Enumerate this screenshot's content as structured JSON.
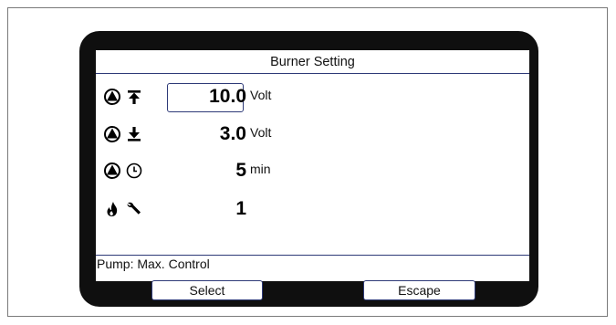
{
  "screen": {
    "title": "Burner Setting",
    "rows": [
      {
        "icons": [
          "pump-icon",
          "arrow-up-to-bar-icon"
        ],
        "value": "10.0",
        "unit": "Volt",
        "selected": true
      },
      {
        "icons": [
          "pump-icon",
          "arrow-down-to-bar-icon"
        ],
        "value": "3.0",
        "unit": "Volt",
        "selected": false
      },
      {
        "icons": [
          "pump-icon",
          "clock-icon"
        ],
        "value": "5",
        "unit": "min",
        "selected": false
      },
      {
        "icons": [
          "flame-icon",
          "wrench-icon"
        ],
        "value": "1",
        "unit": "",
        "selected": false
      }
    ],
    "status": "Pump: Max. Control"
  },
  "softkeys": {
    "select_label": "Select",
    "escape_label": "Escape"
  },
  "colors": {
    "device_body": "#0f0f0f",
    "accent_line": "#2e3a78",
    "screen_background": "#ffffff"
  }
}
